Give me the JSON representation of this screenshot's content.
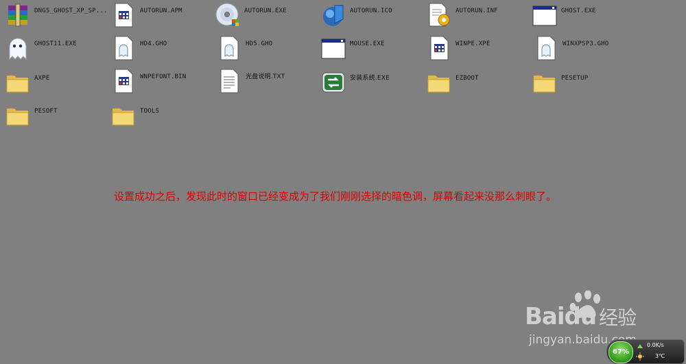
{
  "files": [
    {
      "label": "DNGS_GHOST_XP_SP...",
      "icon": "winrar-archive-icon"
    },
    {
      "label": "AUTORUN.APM",
      "icon": "apm-file-icon"
    },
    {
      "label": "AUTORUN.EXE",
      "icon": "cd-autorun-icon"
    },
    {
      "label": "AUTORUN.ICO",
      "icon": "ico-file-icon"
    },
    {
      "label": "AUTORUN.INF",
      "icon": "inf-settings-file-icon"
    },
    {
      "label": "GHOST.EXE",
      "icon": "exe-window-icon"
    },
    {
      "label": "GHOST11.EXE",
      "icon": "ghost-icon"
    },
    {
      "label": "HD4.GHO",
      "icon": "gho-file-icon"
    },
    {
      "label": "HD5.GHO",
      "icon": "gho-file-icon"
    },
    {
      "label": "MOUSE.EXE",
      "icon": "exe-window-icon"
    },
    {
      "label": "WINPE.XPE",
      "icon": "xpe-file-icon"
    },
    {
      "label": "WINXPSP3.GHO",
      "icon": "gho-file-icon"
    },
    {
      "label": "AXPE",
      "icon": "folder-icon"
    },
    {
      "label": "WNPEFONT.BIN",
      "icon": "bin-file-icon"
    },
    {
      "label": "光盘说明.TXT",
      "icon": "text-file-icon"
    },
    {
      "label": "安装系统.EXE",
      "icon": "install-system-icon"
    },
    {
      "label": "EZBOOT",
      "icon": "folder-icon"
    },
    {
      "label": "PESETUP",
      "icon": "folder-icon"
    },
    {
      "label": "PESOFT",
      "icon": "folder-icon"
    },
    {
      "label": "TOOLS",
      "icon": "folder-icon"
    }
  ],
  "annotation": "设置成功之后，发现此时的窗口已经变成为了我们刚刚选择的暗色调，屏幕看起来没那么刺眼了。",
  "watermark": {
    "brand": "Bai",
    "brand_du": "du",
    "brand_cn": "经验",
    "url": "jingyan.baidu.com"
  },
  "widget": {
    "percent": "67%",
    "speed": "0.0K/s",
    "temp": "3℃"
  },
  "colors": {
    "background": "#808080",
    "annotation": "#e00000",
    "folder": "#f5d56a",
    "gauge_green": "#2e9a1a"
  }
}
